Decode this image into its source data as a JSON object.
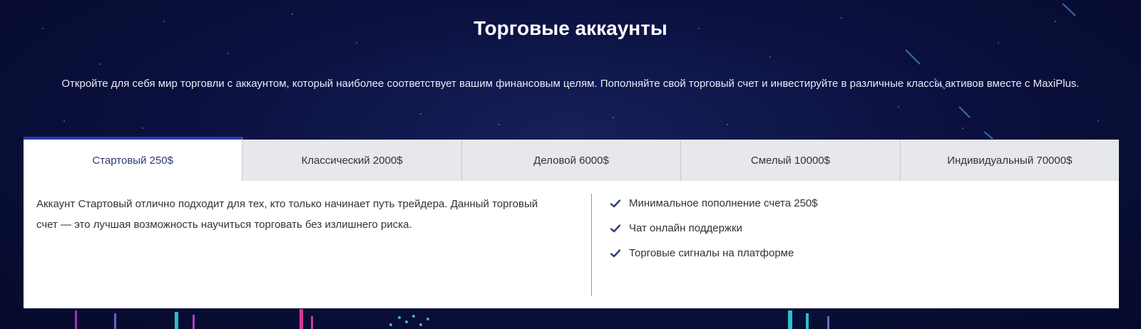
{
  "header": {
    "title": "Торговые аккаунты",
    "subtitle": "Откройте для себя мир торговли с аккаунтом, который наиболее соответствует вашим финансовым целям. Пополняйте свой торговый счет и инвестируйте в различные классы активов вместе с MaxiPlus."
  },
  "tabs": [
    {
      "label": "Стартовый 250$",
      "active": true
    },
    {
      "label": "Классический 2000$",
      "active": false
    },
    {
      "label": "Деловой 6000$",
      "active": false
    },
    {
      "label": "Смелый 10000$",
      "active": false
    },
    {
      "label": "Индивидуальный 70000$",
      "active": false
    }
  ],
  "panel": {
    "description": "Аккаунт Стартовый отлично подходит для тех, кто только начинает путь трейдера. Данный торговый счет — это лучшая возможность научиться торговать без излишнего риска.",
    "features": [
      {
        "icon": "check-icon",
        "text": "Минимальное пополнение счета 250$"
      },
      {
        "icon": "check-icon",
        "text": "Чат онлайн поддержки"
      },
      {
        "icon": "check-icon",
        "text": "Торговые сигналы на платформе"
      }
    ]
  },
  "colors": {
    "background": "#0b1140",
    "active_tab_border": "#2a3aa8",
    "active_tab_text": "#2c3a78",
    "inactive_tab_bg": "#e7e8ec",
    "check": "#2c3a78"
  }
}
